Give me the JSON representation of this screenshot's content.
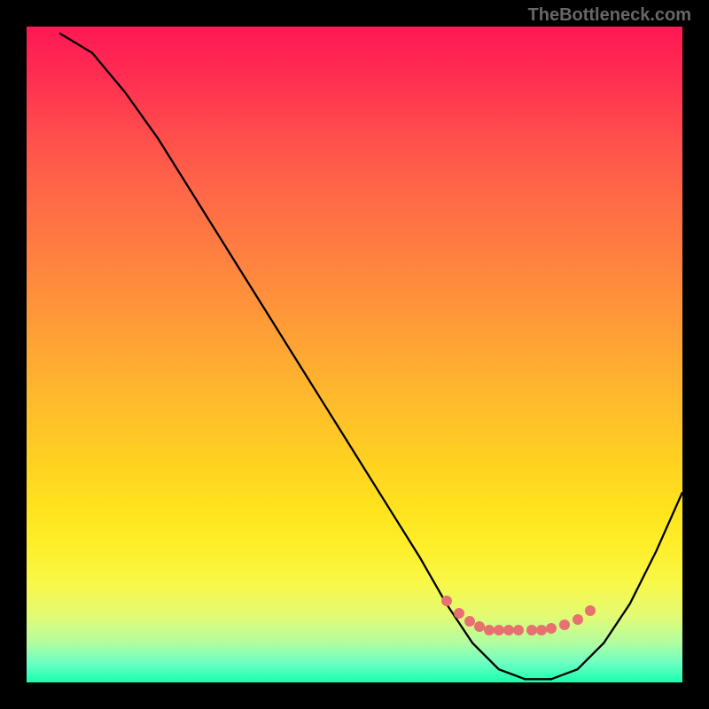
{
  "watermark": "TheBottleneck.com",
  "chart_data": {
    "type": "line",
    "title": "",
    "xlabel": "",
    "ylabel": "",
    "xlim": [
      0,
      100
    ],
    "ylim": [
      0,
      100
    ],
    "series": [
      {
        "name": "curve",
        "x": [
          5,
          10,
          15,
          20,
          25,
          30,
          35,
          40,
          45,
          50,
          55,
          60,
          64,
          68,
          72,
          76,
          80,
          84,
          88,
          92,
          96,
          100
        ],
        "y": [
          99,
          96,
          90,
          83,
          75,
          67,
          59,
          51,
          43,
          35,
          27,
          19,
          12,
          6,
          2,
          0.5,
          0.5,
          2,
          6,
          12,
          20,
          29
        ]
      }
    ],
    "markers": {
      "name": "highlight-dots",
      "x": [
        64,
        66,
        67.5,
        69,
        70.5,
        72,
        73.5,
        75,
        77,
        78.5,
        80,
        82,
        84,
        86
      ],
      "y": [
        12.5,
        10.5,
        9.3,
        8.5,
        8,
        8,
        8,
        8,
        8,
        8,
        8.2,
        8.8,
        9.6,
        11
      ]
    }
  }
}
